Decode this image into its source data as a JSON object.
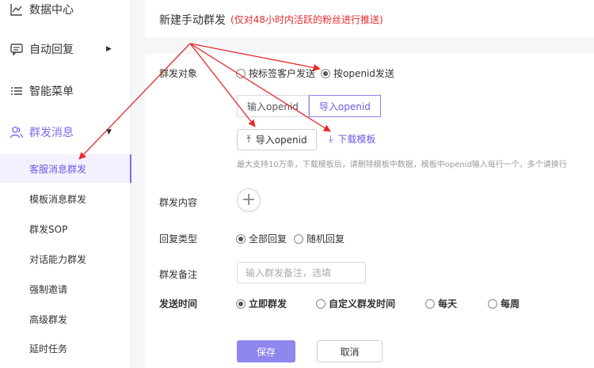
{
  "sidebar": {
    "items": [
      {
        "label": "数据中心",
        "icon": "chart-line-icon"
      },
      {
        "label": "自动回复",
        "icon": "message-icon"
      },
      {
        "label": "智能菜单",
        "icon": "list-icon"
      },
      {
        "label": "群发消息",
        "icon": "users-icon"
      }
    ],
    "sub_items": [
      {
        "label": "客服消息群发"
      },
      {
        "label": "模板消息群发"
      },
      {
        "label": "群发SOP"
      },
      {
        "label": "对话能力群发"
      },
      {
        "label": "强制邀请"
      },
      {
        "label": "高级群发"
      },
      {
        "label": "延时任务"
      }
    ]
  },
  "header": {
    "title": "新建手动群发",
    "tip": "(仅对48小时内活跃的粉丝进行推送)"
  },
  "form": {
    "target_label": "群发对象",
    "target_options": [
      "按标签客户发送",
      "按openid发送"
    ],
    "target_selected": 1,
    "tabs": [
      "输入openid",
      "导入openid"
    ],
    "tab_selected": 1,
    "import_button": "导入openid",
    "download_link": "下载模板",
    "hint": "最大支持10万条，下载模板后，请删除模板中数据，模板中openid输入每行一个，多个请换行",
    "content_label": "群发内容",
    "reply_label": "回复类型",
    "reply_options": [
      "全部回复",
      "随机回复"
    ],
    "reply_selected": 0,
    "remark_label": "群发备注",
    "remark_placeholder": "输入群发备注，选填",
    "time_label": "发送时间",
    "time_options": [
      "立即群发",
      "自定义群发时间",
      "每天",
      "每周"
    ],
    "time_selected": 0,
    "save_label": "保存",
    "cancel_label": "取消"
  },
  "colors": {
    "accent": "#6b5ce7",
    "annotation": "#e62b2b",
    "save_bg": "#8f86ee"
  }
}
